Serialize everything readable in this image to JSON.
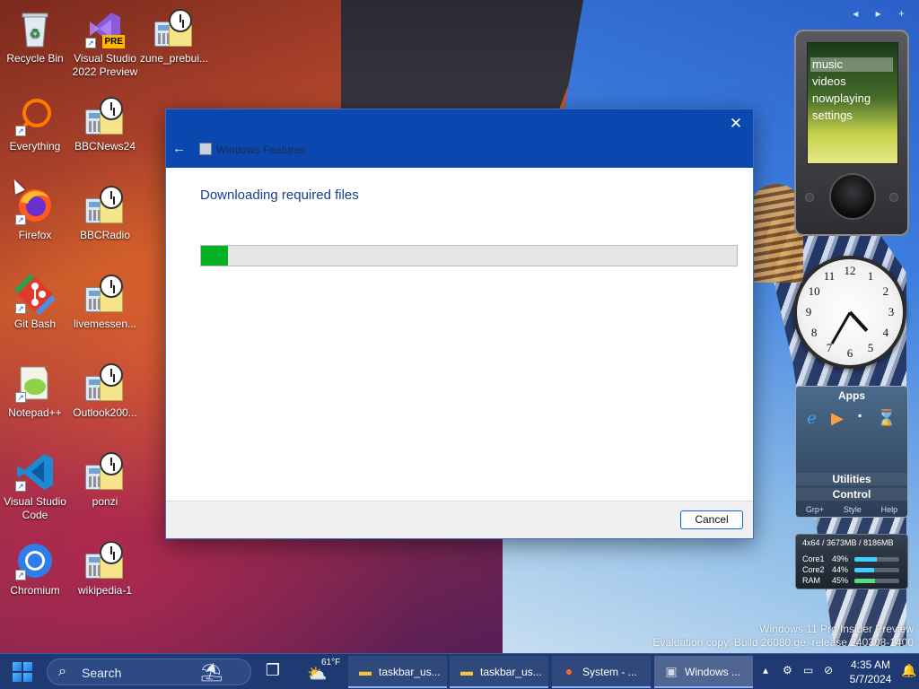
{
  "desktop": {
    "icons": [
      {
        "label": "Recycle Bin",
        "icon": "recycle-bin-icon"
      },
      {
        "label": "Visual Studio 2022 Preview",
        "icon": "visual-studio-icon",
        "badge": "PRE"
      },
      {
        "label": "zune_prebui...",
        "icon": "app-icon"
      },
      {
        "label": "Everything",
        "icon": "search-ring-icon"
      },
      {
        "label": "BBCNews24",
        "icon": "app-icon"
      },
      {
        "label": "Firefox",
        "icon": "firefox-icon"
      },
      {
        "label": "BBCRadio",
        "icon": "app-icon"
      },
      {
        "label": "Git Bash",
        "icon": "git-icon"
      },
      {
        "label": "livemessen...",
        "icon": "app-icon"
      },
      {
        "label": "Notepad++",
        "icon": "notepad-icon"
      },
      {
        "label": "Outlook200...",
        "icon": "app-icon"
      },
      {
        "label": "Visual Studio Code",
        "icon": "vscode-icon"
      },
      {
        "label": "ponzi",
        "icon": "app-icon"
      },
      {
        "label": "Chromium",
        "icon": "chromium-icon"
      },
      {
        "label": "wikipedia-1",
        "icon": "app-icon"
      }
    ],
    "watermark": {
      "line1": "Windows 11 Pro Insider Preview",
      "line2": "Evaluation copy. Build 26080.ge_release.240308-1400"
    }
  },
  "dialog": {
    "window_title": "Windows Features",
    "heading": "Downloading required files",
    "progress_fraction": 0.05,
    "cancel_label": "Cancel",
    "colors": {
      "header": "#0a48b0",
      "progress": "#06b025"
    }
  },
  "zune": {
    "menu": [
      "music",
      "videos",
      "nowplaying",
      "settings"
    ],
    "selected": "music"
  },
  "analog_clock": {
    "numbers": [
      "12",
      "1",
      "2",
      "3",
      "4",
      "5",
      "6",
      "7",
      "8",
      "9",
      "10",
      "11"
    ],
    "time": "4:35"
  },
  "apps_gadget": {
    "title": "Apps",
    "rows": [
      "Utilities",
      "Control"
    ],
    "footer": [
      "Grp+",
      "Style",
      "Help"
    ]
  },
  "sysmon": {
    "header": "4x64 / 3673MB / 8186MB",
    "rows": [
      {
        "label": "Core1",
        "pct": "49%",
        "value": 0.49
      },
      {
        "label": "Core2",
        "pct": "44%",
        "value": 0.44
      },
      {
        "label": "RAM",
        "pct": "45%",
        "value": 0.45
      }
    ]
  },
  "taskbar": {
    "search_label": "Search",
    "weather_temp": "61°F",
    "tasks": [
      {
        "label": "taskbar_us...",
        "icon": "folder-icon"
      },
      {
        "label": "taskbar_us...",
        "icon": "folder-icon"
      },
      {
        "label": "System - ...",
        "icon": "firefox-icon"
      },
      {
        "label": "Windows ...",
        "icon": "windows-features-icon",
        "active": true
      }
    ],
    "time": "4:35 AM",
    "date": "5/7/2024"
  }
}
